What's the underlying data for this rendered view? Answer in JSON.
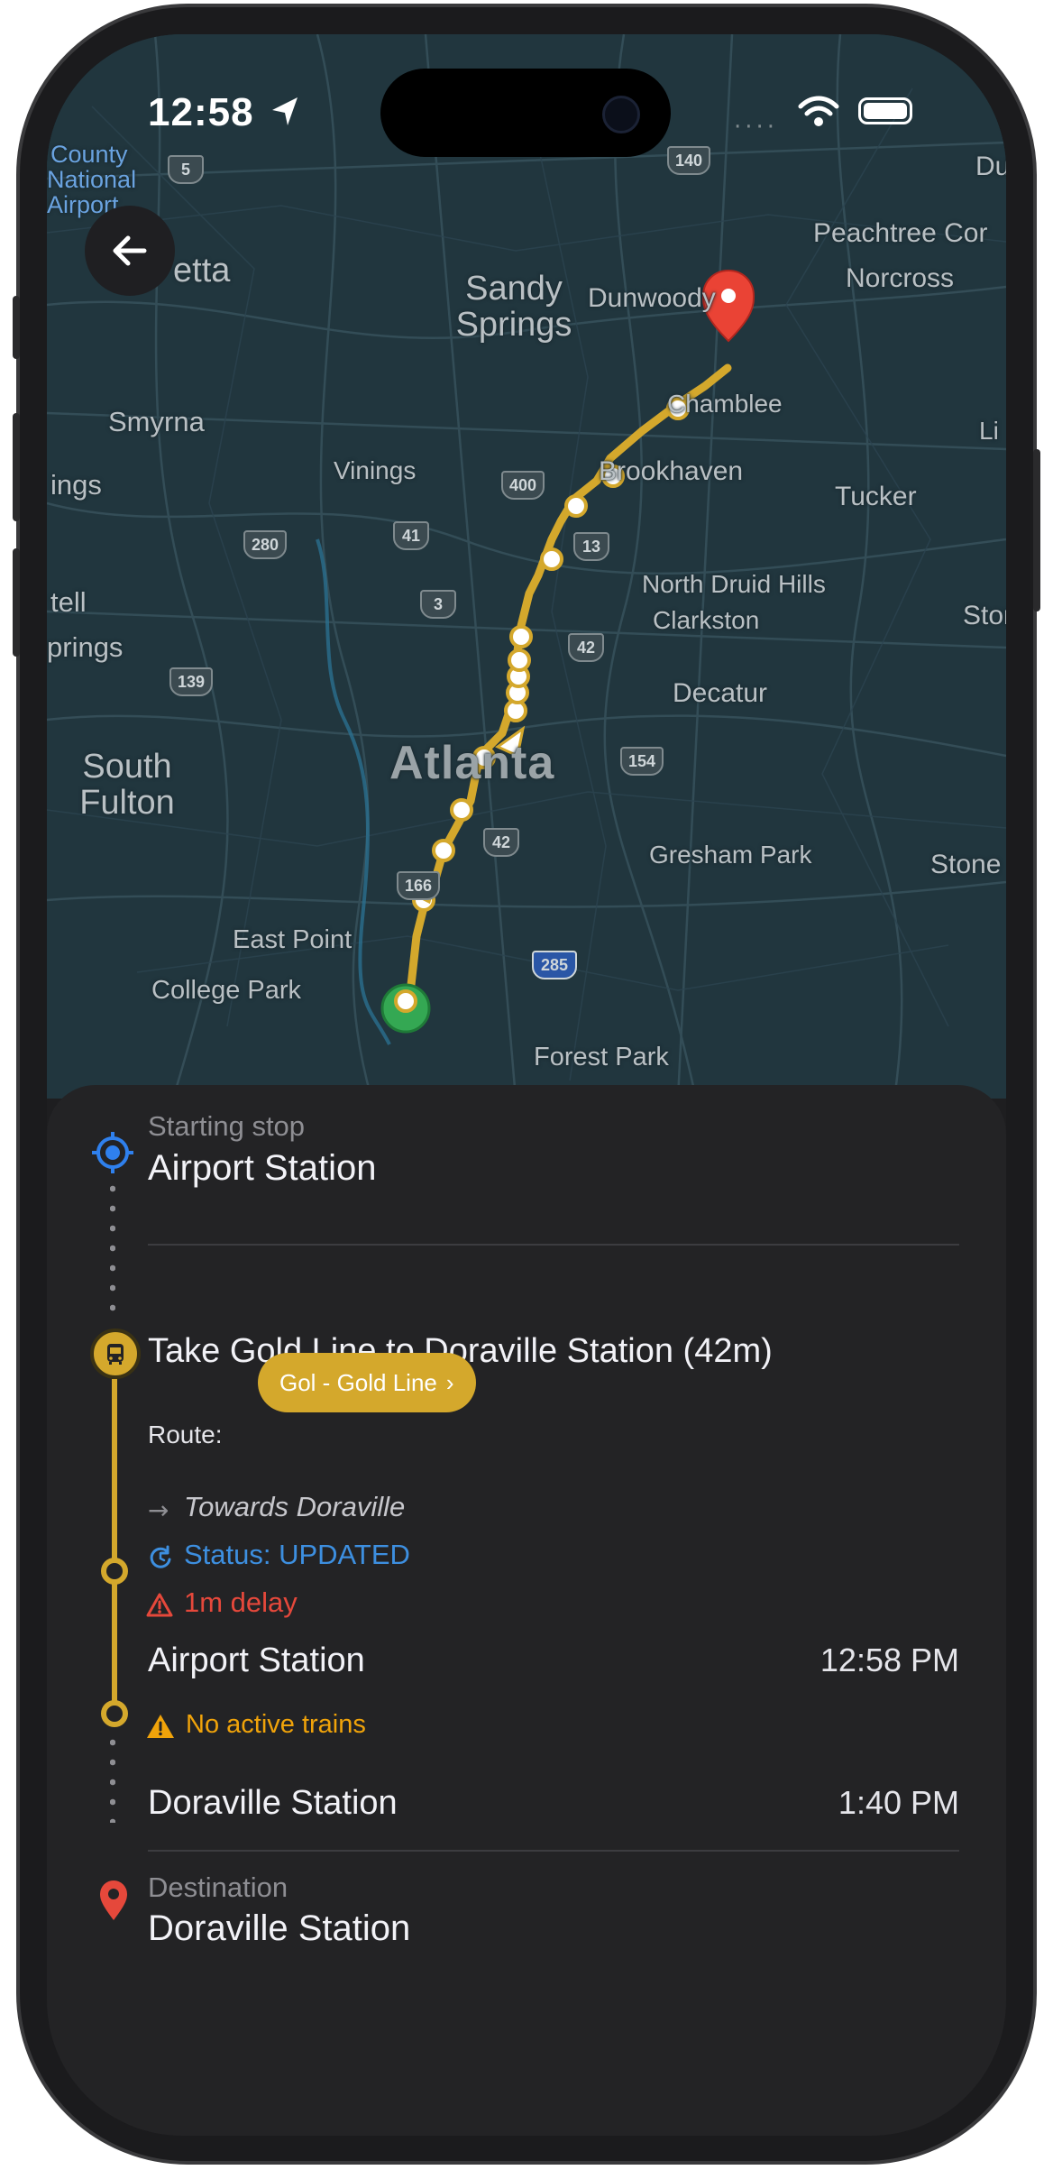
{
  "status_bar": {
    "time": "12:58"
  },
  "map": {
    "labels": {
      "county": "County",
      "national": "National",
      "airport": "Airport",
      "etta": "etta",
      "sandy_springs": "Sandy Springs",
      "dunwoody": "Dunwoody",
      "peachtree_corners": "Peachtree Cor",
      "norcross": "Norcross",
      "smyrna": "Smyrna",
      "chamblee": "Chamblee",
      "vinings": "Vinings",
      "brookhaven": "Brookhaven",
      "tucker": "Tucker",
      "ings": "ings",
      "tell": "tell",
      "prings": "prings",
      "north_druid_hills": "North Druid Hills",
      "clarkston": "Clarkston",
      "stone1": "Stone",
      "decatur": "Decatur",
      "south_fulton": "South Fulton",
      "atlanta": "Atlanta",
      "gresham_park": "Gresham Park",
      "stone2": "Stone",
      "east_point": "East Point",
      "college_park": "College Park",
      "forest_park": "Forest Park",
      "du": "Du",
      "li": "Li"
    },
    "shields": {
      "s5": "5",
      "s140": "140",
      "s400": "400",
      "s280": "280",
      "s41": "41",
      "s13": "13",
      "s3": "3",
      "s42a": "42",
      "s139": "139",
      "s154": "154",
      "s42b": "42",
      "s166": "166",
      "s285": "285"
    },
    "route_color": "#d4a82c"
  },
  "trip": {
    "start": {
      "caption": "Starting stop",
      "name": "Airport Station"
    },
    "step": {
      "title": "Take Gold Line to Doraville Station (42m)",
      "route_label": "Route:",
      "route_pill": "Gol - Gold Line",
      "towards": "Towards Doraville",
      "status": "Status: UPDATED",
      "delay": "1m delay"
    },
    "stops": [
      {
        "name": "Airport Station",
        "time": "12:58 PM"
      },
      {
        "name": "Doraville Station",
        "time": "1:40 PM"
      }
    ],
    "warning": "No active trains",
    "destination": {
      "caption": "Destination",
      "name": "Doraville Station"
    }
  },
  "colors": {
    "gold": "#d4a82c",
    "status_blue": "#3d8fe0",
    "delay_red": "#e5483b",
    "warning_orange": "#f0a30a",
    "start_blue": "#2f80ed"
  }
}
